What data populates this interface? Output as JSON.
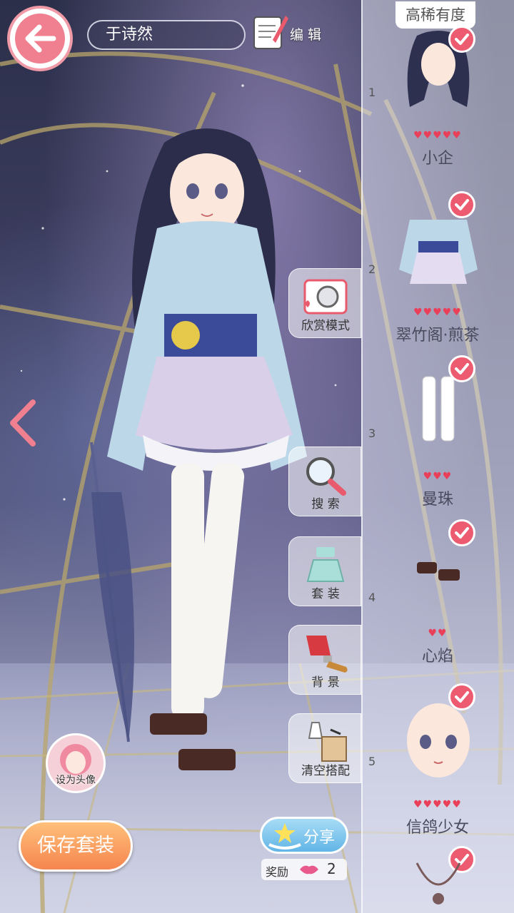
{
  "header": {
    "player_name": "于诗然",
    "edit_label": "编 辑"
  },
  "panel": {
    "title": "高稀有度",
    "items": [
      {
        "index": "1",
        "name": "小企",
        "hearts": 5
      },
      {
        "index": "2",
        "name": "翠竹阁·煎茶",
        "hearts": 5
      },
      {
        "index": "3",
        "name": "曼珠",
        "hearts": 3
      },
      {
        "index": "4",
        "name": "心焰",
        "hearts": 2
      },
      {
        "index": "5",
        "name": "信鸽少女",
        "hearts": 5
      }
    ]
  },
  "functions": {
    "appreciate": "欣赏模式",
    "search": "搜 索",
    "suit": "套 装",
    "background": "背 景",
    "clear": "清空搭配"
  },
  "avatar_label": "设为头像",
  "save_label": "保存套装",
  "share_label": "分享",
  "reward": {
    "label": "奖励",
    "count": "2"
  },
  "colors": {
    "accent_pink": "#ec5b70",
    "save_orange": "#f5854f",
    "share_blue": "#62b5e6"
  }
}
